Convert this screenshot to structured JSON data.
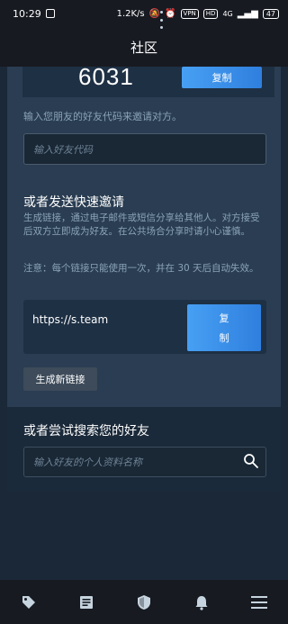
{
  "status_bar": {
    "time": "10:29",
    "speed": "1.2K/s",
    "vpn": "VPN",
    "hd": "HD",
    "network": "4G",
    "battery": "47"
  },
  "header": {
    "title": "社区"
  },
  "friend_code": {
    "code": "6031",
    "copy_label": "复制",
    "hint": "输入您朋友的好友代码来邀请对方。",
    "input_placeholder": "输入好友代码"
  },
  "quick_invite": {
    "title": "或者发送快速邀请",
    "description": "生成链接，通过电子邮件或短信分享给其他人。对方接受后双方立即成为好友。在公共场合分享时请小心谨慎。",
    "note": "注意：每个链接只能使用一次，并在 30 天后自动失效。",
    "link": "https://s.team",
    "copy_label_line1": "复",
    "copy_label_line2": "制",
    "generate_label": "生成新链接"
  },
  "search": {
    "title": "或者尝试搜索您的好友",
    "placeholder": "输入好友的个人资料名称"
  },
  "bottom_nav": {
    "items": [
      "tag-icon",
      "news-icon",
      "shield-icon",
      "bell-icon",
      "menu-icon"
    ]
  }
}
